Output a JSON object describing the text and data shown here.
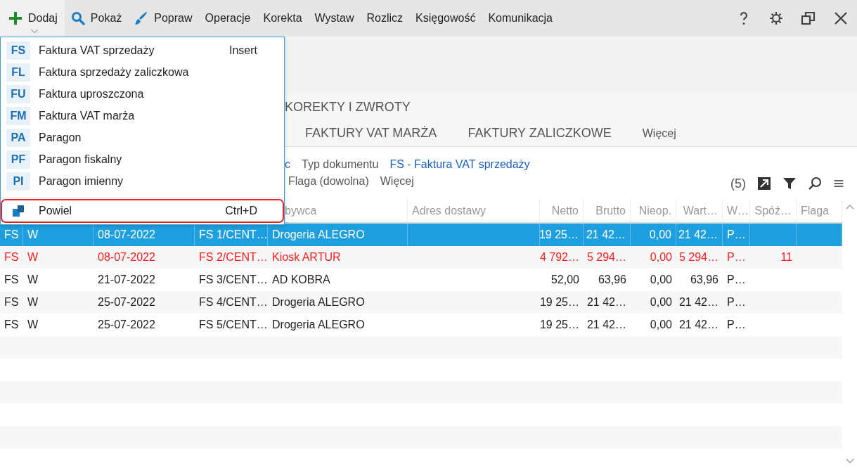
{
  "toolbar": {
    "items": [
      {
        "label": "Dodaj",
        "active": true
      },
      {
        "label": "Pokaż",
        "active": false
      },
      {
        "label": "Popraw",
        "active": false
      },
      {
        "label": "Operacje",
        "active": false
      },
      {
        "label": "Korekta",
        "active": false
      },
      {
        "label": "Wystaw",
        "active": false
      },
      {
        "label": "Rozlicz",
        "active": false
      },
      {
        "label": "Księgowość",
        "active": false
      },
      {
        "label": "Komunikacja",
        "active": false
      }
    ]
  },
  "menu": {
    "items": [
      {
        "kind": "badge",
        "badge": "FS",
        "label": "Faktura VAT sprzedaży",
        "shortcut": "Insert",
        "highlighted": false
      },
      {
        "kind": "badge",
        "badge": "FL",
        "label": "Faktura sprzedaży zaliczkowa",
        "highlighted": false
      },
      {
        "kind": "badge",
        "badge": "FU",
        "label": "Faktura uproszczona",
        "highlighted": false
      },
      {
        "kind": "badge",
        "badge": "FM",
        "label": "Faktura VAT marża",
        "highlighted": false
      },
      {
        "kind": "badge",
        "badge": "PA",
        "label": "Paragon",
        "highlighted": false
      },
      {
        "kind": "badge",
        "badge": "PF",
        "label": "Paragon fiskalny",
        "highlighted": false
      },
      {
        "kind": "badge",
        "badge": "PI",
        "label": "Paragon imienny",
        "highlighted": false
      },
      {
        "kind": "separator"
      },
      {
        "kind": "copy",
        "label": "Powiel",
        "shortcut": "Ctrl+D",
        "highlighted": true
      }
    ]
  },
  "tabs": {
    "row_1": [
      {
        "label": "KOREKTY I ZWROTY",
        "selected": false
      }
    ],
    "row_2": [
      {
        "label": "FAKTURY VAT MARŻA",
        "selected": false
      },
      {
        "label": "FAKTURY ZALICZKOWE",
        "selected": false
      }
    ],
    "more": "Więcej"
  },
  "filters": {
    "line_1": {
      "cut_text": "c",
      "label": "Typ dokumentu",
      "value": "FS - Faktura VAT sprzedaży"
    },
    "line_2": [
      "Flaga (dowolna)",
      "Więcej"
    ],
    "count": "(5)"
  },
  "table": {
    "headers": [
      "bywca",
      "Adres dostawy",
      "Netto",
      "Brutto",
      "Nieop.",
      "Wart…",
      "W…",
      "Spóź…",
      "Flaga"
    ],
    "rows": [
      {
        "type": "FS",
        "status": "W",
        "date": "08-07-2022",
        "number": "FS 1/CENT…",
        "buyer": "Drogeria ALEGRO",
        "netto": "19 25…",
        "brutto": "21 42…",
        "unpaid": "0,00",
        "value": "21 42…",
        "w": "P…",
        "selected": true,
        "overdue": false
      },
      {
        "type": "FS",
        "status": "W",
        "date": "08-07-2022",
        "number": "FS 2/CENT…",
        "buyer": "Kiosk ARTUR",
        "netto": "4 792…",
        "brutto": "5 294…",
        "unpaid": "0,00",
        "value": "5 294…",
        "w": "P…",
        "delay": "11",
        "selected": false,
        "overdue": true
      },
      {
        "type": "FS",
        "status": "W",
        "date": "21-07-2022",
        "number": "FS 3/CENT…",
        "buyer": "AD KOBRA",
        "netto": "52,00",
        "brutto": "63,96",
        "unpaid": "0,00",
        "value": "63,96",
        "w": "P…",
        "selected": false,
        "overdue": false
      },
      {
        "type": "FS",
        "status": "W",
        "date": "25-07-2022",
        "number": "FS 4/CENT…",
        "buyer": "Drogeria ALEGRO",
        "netto": "19 25…",
        "brutto": "21 42…",
        "unpaid": "0,00",
        "value": "21 42…",
        "w": "P…",
        "selected": false,
        "overdue": false
      },
      {
        "type": "FS",
        "status": "W",
        "date": "25-07-2022",
        "number": "FS 5/CENT…",
        "buyer": "Drogeria ALEGRO",
        "netto": "19 25…",
        "brutto": "21 42…",
        "unpaid": "0,00",
        "value": "21 42…",
        "w": "P…",
        "selected": false,
        "overdue": false
      }
    ]
  }
}
